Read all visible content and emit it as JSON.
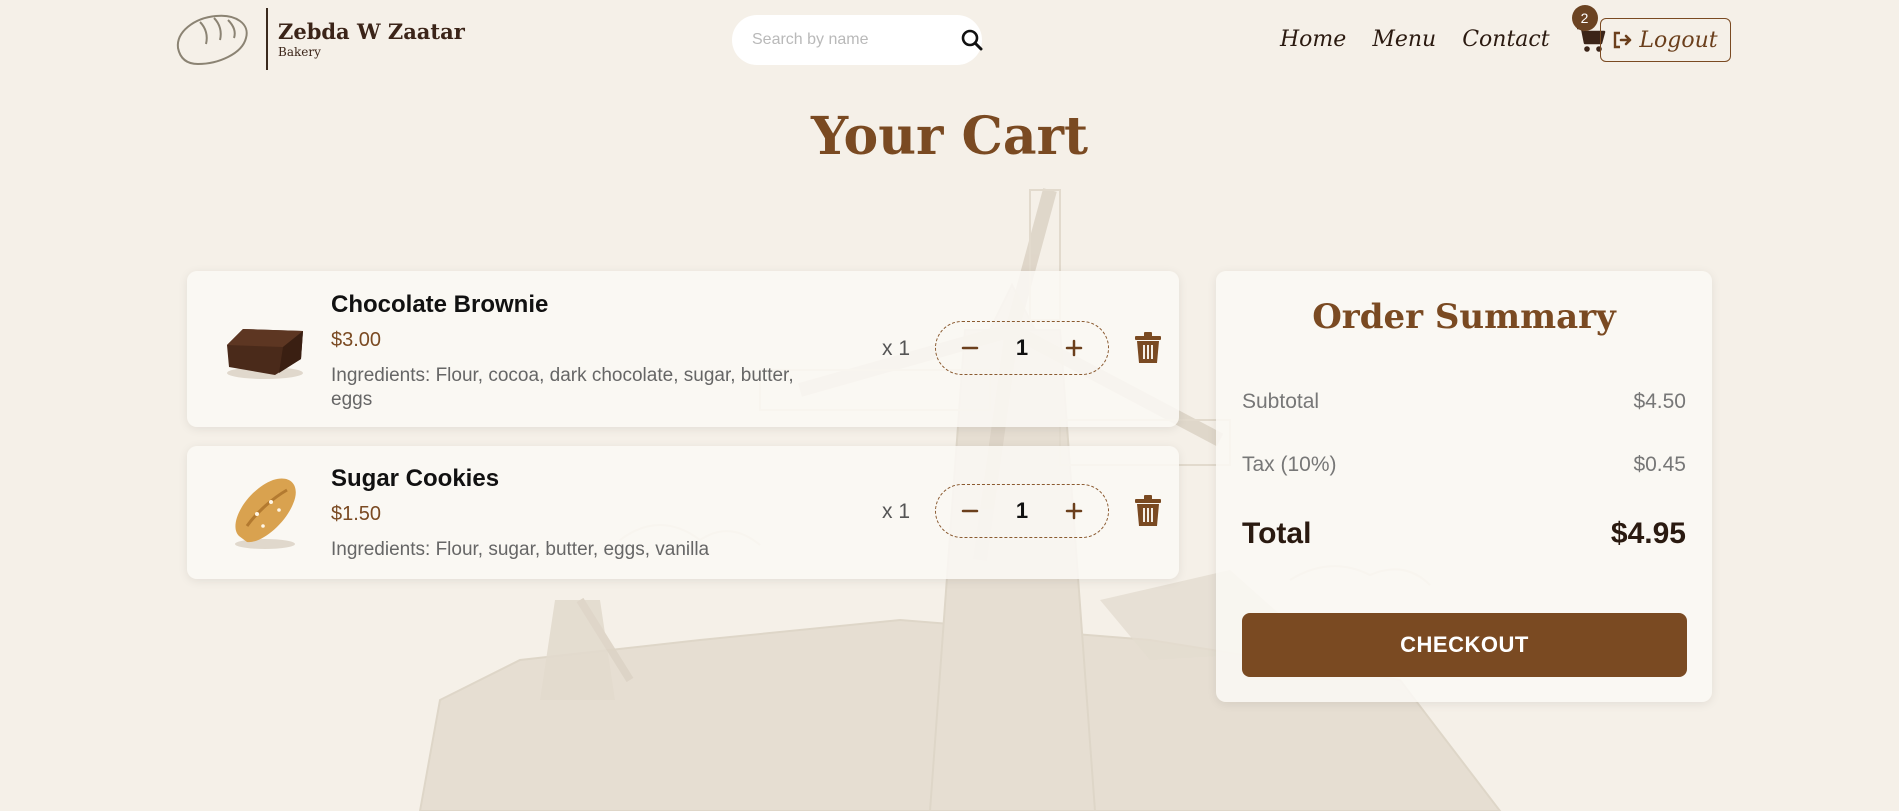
{
  "brand": {
    "name": "Zebda W Zaatar",
    "tagline": "Bakery"
  },
  "search": {
    "placeholder": "Search by name",
    "value": ""
  },
  "nav": {
    "home": "Home",
    "menu": "Menu",
    "contact": "Contact",
    "cart_count": "2",
    "logout": "Logout"
  },
  "page": {
    "title": "Your Cart"
  },
  "cart": {
    "items": [
      {
        "name": "Chocolate Brownie",
        "price": "$3.00",
        "ingredients": "Ingredients: Flour, cocoa, dark chocolate, sugar, butter, eggs",
        "qty_label": "x 1",
        "quantity": "1",
        "image_icon": "brownie-image"
      },
      {
        "name": "Sugar Cookies",
        "price": "$1.50",
        "ingredients": "Ingredients: Flour, sugar, butter, eggs, vanilla",
        "qty_label": "x 1",
        "quantity": "1",
        "image_icon": "cookie-image"
      }
    ]
  },
  "summary": {
    "title": "Order Summary",
    "subtotal_label": "Subtotal",
    "subtotal_value": "$4.50",
    "tax_label": "Tax (10%)",
    "tax_value": "$0.45",
    "total_label": "Total",
    "total_value": "$4.95",
    "checkout_label": "CHECKOUT"
  },
  "colors": {
    "background": "#f5f0e8",
    "accent": "#7a4a22",
    "text_dark": "#2a1a10"
  }
}
